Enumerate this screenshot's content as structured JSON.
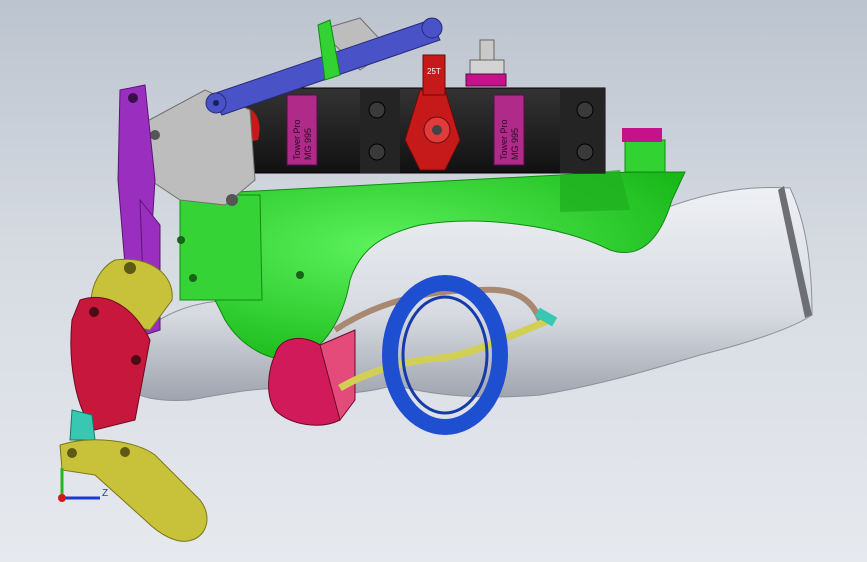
{
  "viewport": {
    "background_top": "#bcc4cf",
    "background_bottom": "#e6e9ee"
  },
  "servos": {
    "left_label_brand": "Tower Pro",
    "left_label_model": "MG 995",
    "right_label_brand": "Tower Pro",
    "right_label_model": "MG 995"
  },
  "horn_label": "25T",
  "triad": {
    "z_label": "Z"
  },
  "colors": {
    "arm_shell": "#f3f4f6",
    "arm_shell_shadow": "#b9bcc4",
    "mount": "#2ed52e",
    "mount_dark": "#1d9a1d",
    "servo_body": "#1b1b1b",
    "servo_label": "#b02a8a",
    "horn": "#c61a1a",
    "link_blue": "#4a52c8",
    "finger_red": "#c8173c",
    "finger_yellow": "#c7c23a",
    "finger_purple": "#9a2fbf",
    "gray_link": "#bdbdbd",
    "ring": "#1f4fd1",
    "cup": "#d01a5a",
    "spring": "#d2d054",
    "magenta_block": "#c5118a"
  },
  "icons": [
    "servo-icon",
    "triad-icon",
    "ring-icon"
  ]
}
